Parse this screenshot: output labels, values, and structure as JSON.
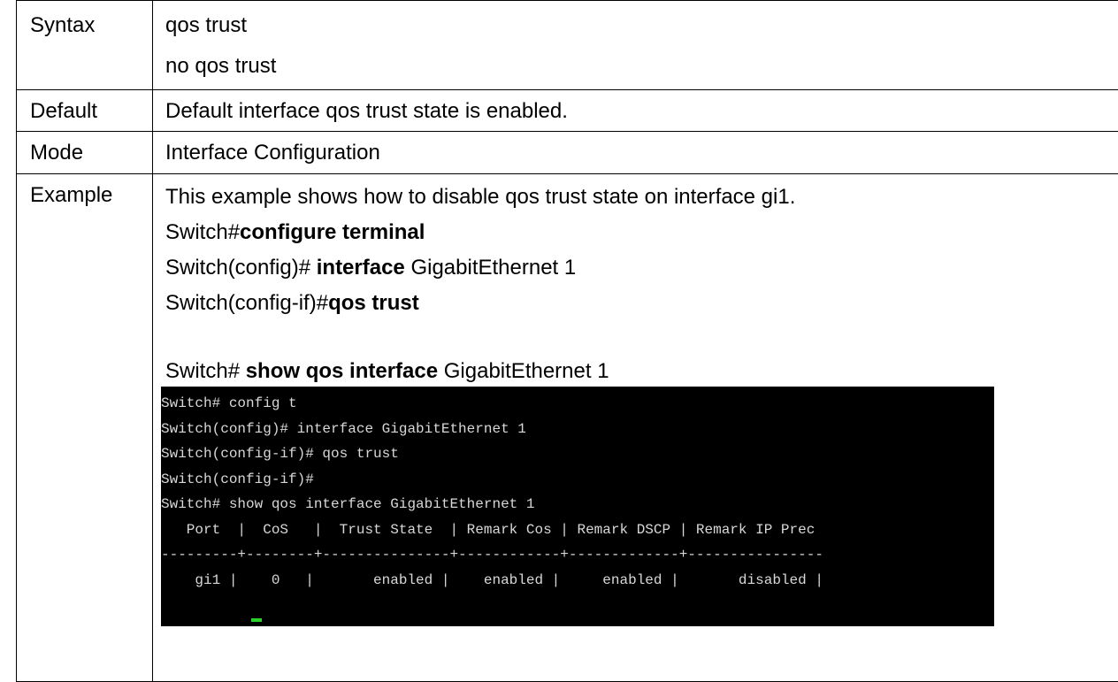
{
  "rows": {
    "syntax": {
      "label": "Syntax",
      "line1": "qos trust",
      "line2": "no qos trust"
    },
    "default": {
      "label": "Default",
      "text": "Default interface qos trust state is enabled."
    },
    "mode": {
      "label": "Mode",
      "text": "Interface Configuration"
    },
    "example": {
      "label": "Example",
      "description": "This example shows how to disable qos trust state on interface gi1.",
      "cmd1_prefix": "Switch#",
      "cmd1_command": "configure terminal",
      "cmd2_prefix": "Switch(config)# ",
      "cmd2_command": "interface",
      "cmd2_arg": " GigabitEthernet 1",
      "cmd3_prefix": "Switch(config-if)#",
      "cmd3_command": "qos trust",
      "cmd4_prefix": "Switch# ",
      "cmd4_command": "show qos interface",
      "cmd4_arg": " GigabitEthernet 1"
    }
  },
  "terminal": {
    "lines": [
      "Switch# config t",
      "Switch(config)# interface GigabitEthernet 1",
      "Switch(config-if)# qos trust",
      "Switch(config-if)#",
      "Switch# show qos interface GigabitEthernet 1",
      "   Port  |  CoS   |  Trust State  | Remark Cos | Remark DSCP | Remark IP Prec",
      "---------+--------+---------------+------------+-------------+----------------",
      "    gi1 |    0   |       enabled |    enabled |     enabled |       disabled |"
    ],
    "colors": {
      "background": "#000000",
      "text": "#d8d8d8",
      "cursor": "#2bd12b"
    }
  }
}
